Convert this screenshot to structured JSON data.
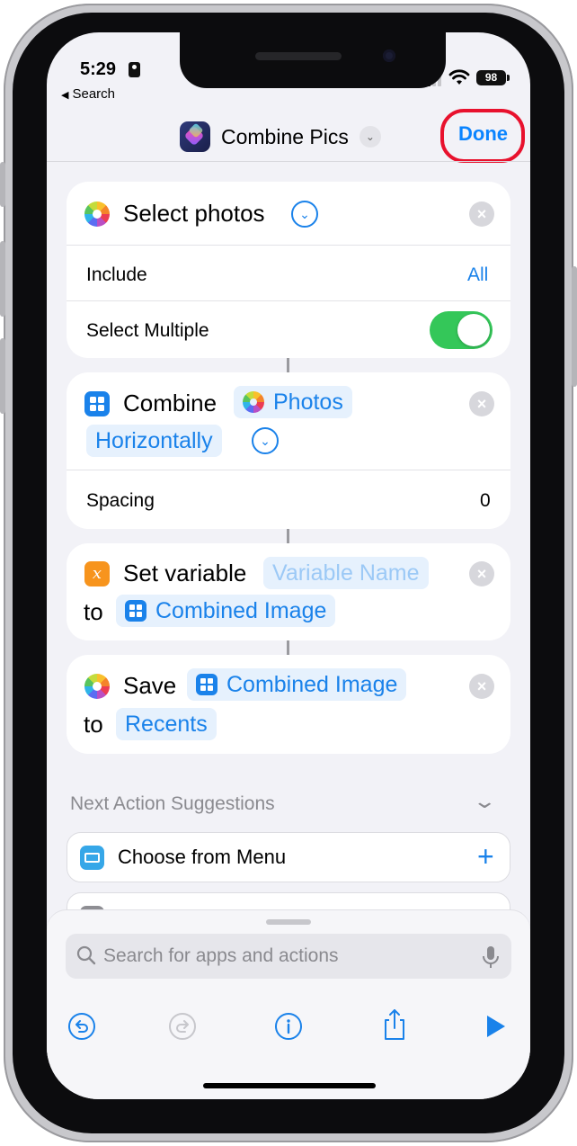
{
  "status_bar": {
    "time": "5:29",
    "back_label": "Search",
    "battery": "98"
  },
  "nav": {
    "title": "Combine Pics",
    "done_label": "Done"
  },
  "actions": {
    "select_photos": {
      "title": "Select photos",
      "include_label": "Include",
      "include_value": "All",
      "multiple_label": "Select Multiple",
      "multiple_on": true
    },
    "combine": {
      "title": "Combine",
      "images_param": "Photos",
      "mode_param": "Horizontally",
      "spacing_label": "Spacing",
      "spacing_value": "0"
    },
    "set_variable": {
      "title": "Set variable",
      "name_placeholder": "Variable Name",
      "to_label": "to",
      "value_param": "Combined Image"
    },
    "save": {
      "title": "Save",
      "item_param": "Combined Image",
      "to_label": "to",
      "album_param": "Recents"
    }
  },
  "suggestions": {
    "heading": "Next Action Suggestions",
    "items": [
      {
        "label": "Choose from Menu",
        "icon": "menu-icon"
      }
    ]
  },
  "sheet": {
    "search_placeholder": "Search for apps and actions"
  },
  "colors": {
    "accent": "#1a82ea",
    "toggle_on": "#34c759",
    "highlight_ring": "#e8112d",
    "background": "#f2f2f7"
  }
}
